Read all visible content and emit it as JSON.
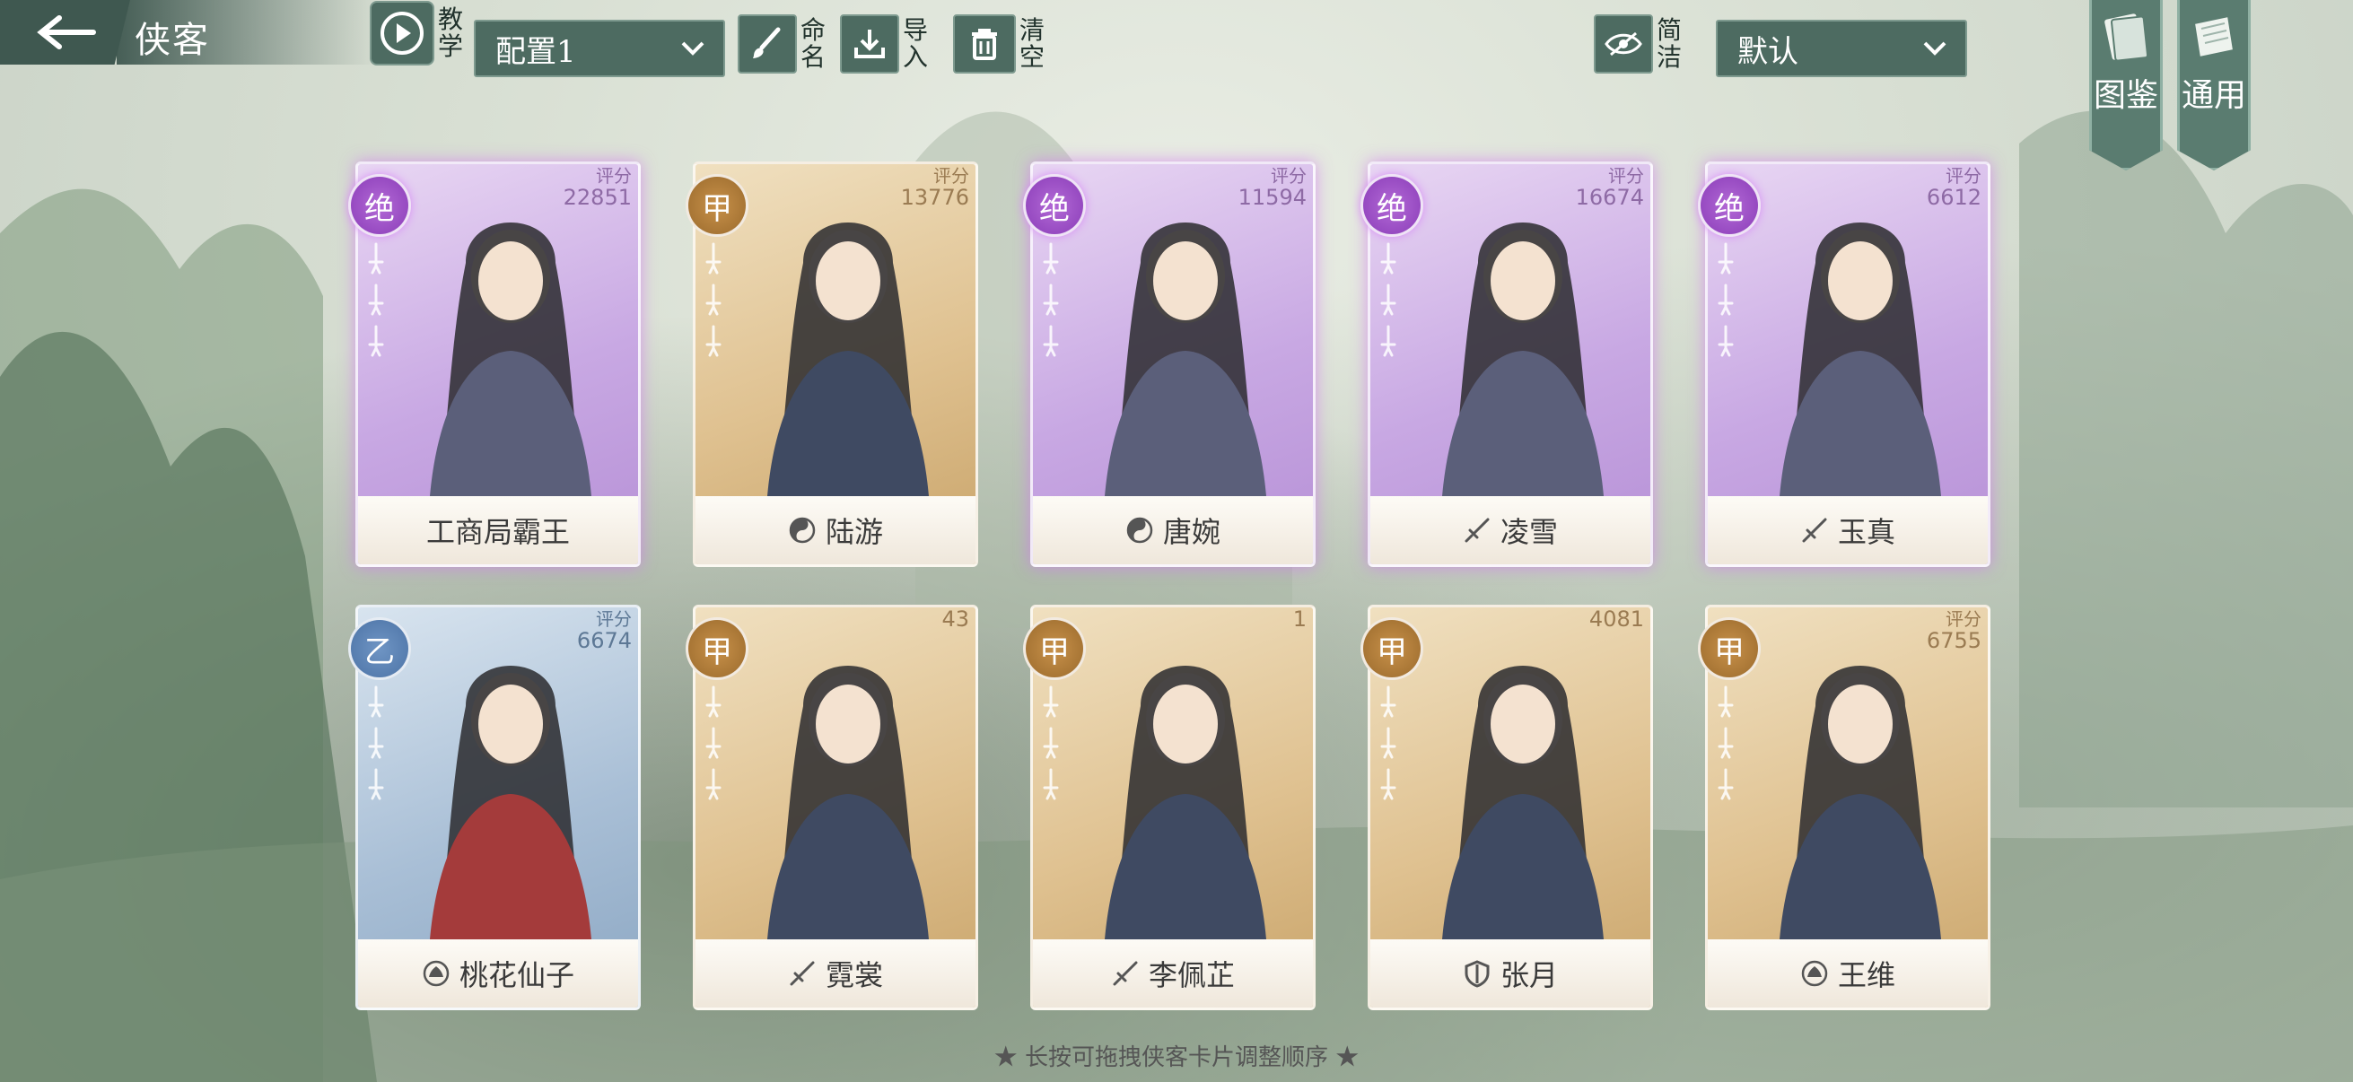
{
  "header": {
    "title": "侠客",
    "tutorial_label": "教学",
    "config_select": "配置1",
    "rename_label": "命名",
    "import_label": "导入",
    "clear_label": "清空",
    "simplify_label": "简洁",
    "sort_select": "默认"
  },
  "side_tabs": [
    {
      "label": "图鉴",
      "icon": "book-icon"
    },
    {
      "label": "通用",
      "icon": "scroll-icon"
    }
  ],
  "cards": [
    {
      "name": "工商局霸王",
      "rank": "绝",
      "score_label": "评分",
      "score": "22851",
      "tier": "purple",
      "faction_icon": "",
      "stars": 3
    },
    {
      "name": "陆游",
      "rank": "甲",
      "score_label": "评分",
      "score": "13776",
      "tier": "gold",
      "faction_icon": "taiji-icon",
      "stars": 3
    },
    {
      "name": "唐婉",
      "rank": "绝",
      "score_label": "评分",
      "score": "11594",
      "tier": "purple",
      "faction_icon": "taiji-icon",
      "stars": 3
    },
    {
      "name": "凌雪",
      "rank": "绝",
      "score_label": "评分",
      "score": "16674",
      "tier": "purple",
      "faction_icon": "sword-icon",
      "stars": 3
    },
    {
      "name": "玉真",
      "rank": "绝",
      "score_label": "评分",
      "score": "6612",
      "tier": "purple",
      "faction_icon": "sword-icon",
      "stars": 3
    },
    {
      "name": "桃花仙子",
      "rank": "乙",
      "score_label": "评分",
      "score": "6674",
      "tier": "blue",
      "faction_icon": "lotus-icon",
      "stars": 3
    },
    {
      "name": "霓裳",
      "rank": "甲",
      "score_label": "",
      "score": "43",
      "tier": "gold",
      "faction_icon": "sword-icon",
      "stars": 3
    },
    {
      "name": "李佩芷",
      "rank": "甲",
      "score_label": "",
      "score": "1",
      "tier": "gold",
      "faction_icon": "sword-icon",
      "stars": 3
    },
    {
      "name": "张月",
      "rank": "甲",
      "score_label": "",
      "score": "4081",
      "tier": "gold",
      "faction_icon": "shield-icon",
      "stars": 3
    },
    {
      "name": "王维",
      "rank": "甲",
      "score_label": "评分",
      "score": "6755",
      "tier": "gold",
      "faction_icon": "lotus-icon",
      "stars": 3
    }
  ],
  "footer": {
    "hint": "★ 长按可拖拽侠客卡片调整顺序 ★"
  }
}
